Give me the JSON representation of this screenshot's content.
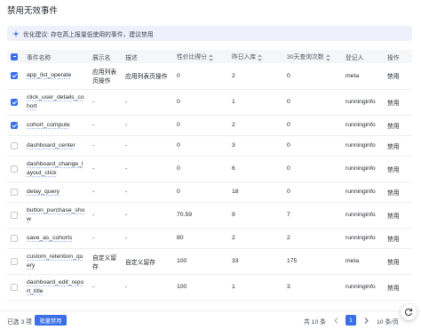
{
  "page": {
    "title": "禁用无效事件"
  },
  "tip": {
    "text": "优化建议: 存在高上报量低使用的事件，建议禁用",
    "icon": "sparkle-icon"
  },
  "table": {
    "headers": {
      "name": "事件名称",
      "display_name": "展示名",
      "description": "描述",
      "value_ratio": "性价比得分",
      "yesterday_in": "昨日入库",
      "query_30d": "30天查询次数",
      "registrant": "登记人",
      "action": "操作"
    },
    "rows": [
      {
        "checked": true,
        "name": "app_list_operate",
        "display_name": "应用列表页操作",
        "description": "应用列表页操作",
        "value_ratio": "0",
        "yesterday_in": "2",
        "query_30d": "0",
        "registrant": "meta",
        "action": "禁用"
      },
      {
        "checked": true,
        "name": "click_user_details_cohort",
        "display_name": "-",
        "description": "-",
        "value_ratio": "0",
        "yesterday_in": "1",
        "query_30d": "0",
        "registrant": "runninginfo",
        "action": "禁用"
      },
      {
        "checked": true,
        "name": "cohort_compute",
        "display_name": "-",
        "description": "-",
        "value_ratio": "0",
        "yesterday_in": "2",
        "query_30d": "0",
        "registrant": "runninginfo",
        "action": "禁用"
      },
      {
        "checked": false,
        "name": "dashboard_center",
        "display_name": "-",
        "description": "-",
        "value_ratio": "0",
        "yesterday_in": "3",
        "query_30d": "0",
        "registrant": "runninginfo",
        "action": "禁用"
      },
      {
        "checked": false,
        "name": "dashboard_change_layout_click",
        "display_name": "-",
        "description": "-",
        "value_ratio": "0",
        "yesterday_in": "6",
        "query_30d": "0",
        "registrant": "runninginfo",
        "action": "禁用"
      },
      {
        "checked": false,
        "name": "delay_query",
        "display_name": "-",
        "description": "-",
        "value_ratio": "0",
        "yesterday_in": "18",
        "query_30d": "0",
        "registrant": "runninginfo",
        "action": "禁用"
      },
      {
        "checked": false,
        "name": "button_purchase_show",
        "display_name": "-",
        "description": "-",
        "value_ratio": "70.59",
        "yesterday_in": "9",
        "query_30d": "7",
        "registrant": "runninginfo",
        "action": "禁用"
      },
      {
        "checked": false,
        "name": "save_as_cohorts",
        "display_name": "-",
        "description": "-",
        "value_ratio": "80",
        "yesterday_in": "2",
        "query_30d": "2",
        "registrant": "runninginfo",
        "action": "禁用"
      },
      {
        "checked": false,
        "name": "custom_retention_query",
        "display_name": "自定义留存",
        "description": "自定义留存",
        "value_ratio": "100",
        "yesterday_in": "33",
        "query_30d": "175",
        "registrant": "meta",
        "action": "禁用"
      },
      {
        "checked": false,
        "name": "dashboard_edit_report_title",
        "display_name": "-",
        "description": "-",
        "value_ratio": "100",
        "yesterday_in": "1",
        "query_30d": "3",
        "registrant": "runninginfo",
        "action": "禁用"
      }
    ]
  },
  "footer": {
    "selected_text": "已选 3 项",
    "batch_button": "批量禁用",
    "total_text": "共 10 条",
    "current_page": "1",
    "page_size": "10 条/页"
  },
  "colors": {
    "accent": "#3a6fe8",
    "header_bg": "#f5f6f8",
    "tip_bg": "#eef1fb"
  }
}
